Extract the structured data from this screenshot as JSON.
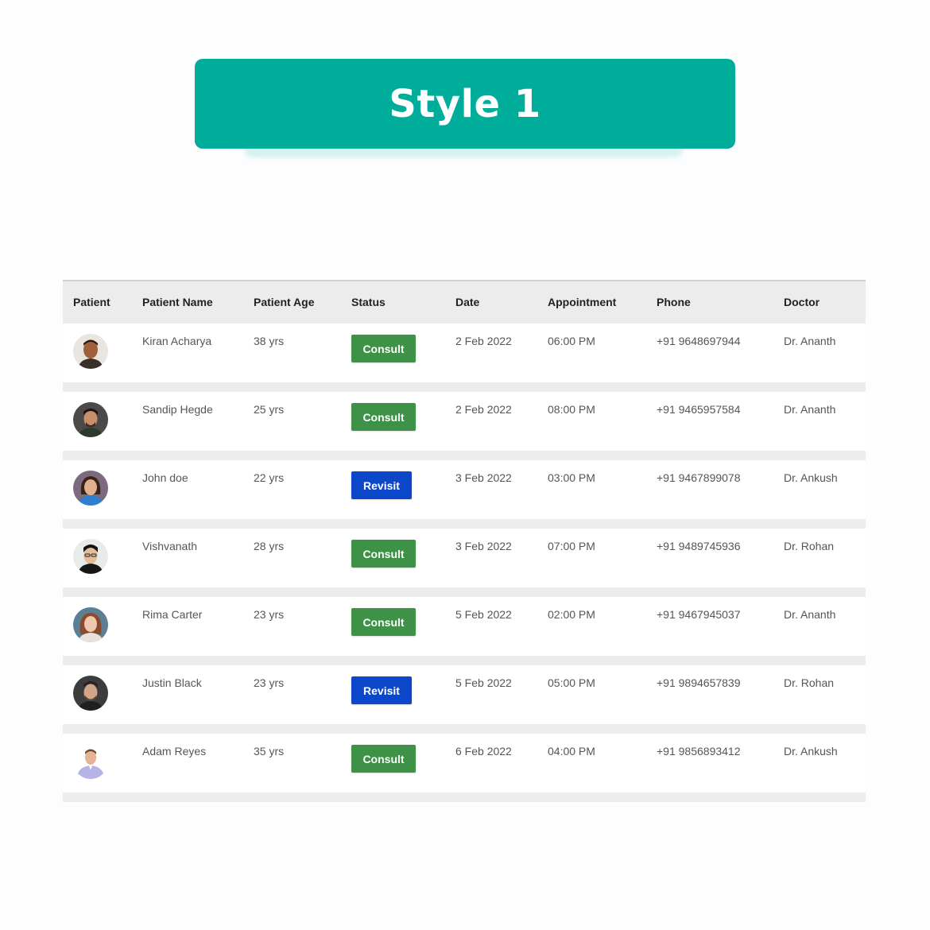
{
  "banner": {
    "title": "Style 1"
  },
  "table": {
    "headers": {
      "patient": "Patient",
      "patient_name": "Patient Name",
      "patient_age": "Patient Age",
      "status": "Status",
      "date": "Date",
      "appointment": "Appointment",
      "phone": "Phone",
      "doctor": "Doctor"
    },
    "rows": [
      {
        "name": "Kiran Acharya",
        "age": "38 yrs",
        "status": "Consult",
        "date": "2 Feb 2022",
        "time": "06:00 PM",
        "phone": "+91 9648697944",
        "doctor": "Dr. Ananth"
      },
      {
        "name": "Sandip Hegde",
        "age": "25 yrs",
        "status": "Consult",
        "date": "2 Feb 2022",
        "time": "08:00 PM",
        "phone": "+91 9465957584",
        "doctor": "Dr. Ananth"
      },
      {
        "name": "John doe",
        "age": "22 yrs",
        "status": "Revisit",
        "date": "3 Feb 2022",
        "time": "03:00 PM",
        "phone": "+91 9467899078",
        "doctor": "Dr. Ankush"
      },
      {
        "name": "Vishvanath",
        "age": "28 yrs",
        "status": "Consult",
        "date": "3 Feb 2022",
        "time": "07:00 PM",
        "phone": "+91 9489745936",
        "doctor": "Dr. Rohan"
      },
      {
        "name": "Rima Carter",
        "age": "23 yrs",
        "status": "Consult",
        "date": "5 Feb 2022",
        "time": "02:00 PM",
        "phone": "+91 9467945037",
        "doctor": "Dr. Ananth"
      },
      {
        "name": "Justin Black",
        "age": "23 yrs",
        "status": "Revisit",
        "date": "5 Feb 2022",
        "time": "05:00 PM",
        "phone": "+91 9894657839",
        "doctor": "Dr. Rohan"
      },
      {
        "name": "Adam Reyes",
        "age": "35 yrs",
        "status": "Consult",
        "date": "6 Feb 2022",
        "time": "04:00 PM",
        "phone": "+91 9856893412",
        "doctor": "Dr. Ankush"
      }
    ]
  },
  "colors": {
    "banner": "#00ad9b",
    "consult": "#3d9248",
    "revisit": "#0b47c8",
    "header_bg": "#ececec"
  }
}
